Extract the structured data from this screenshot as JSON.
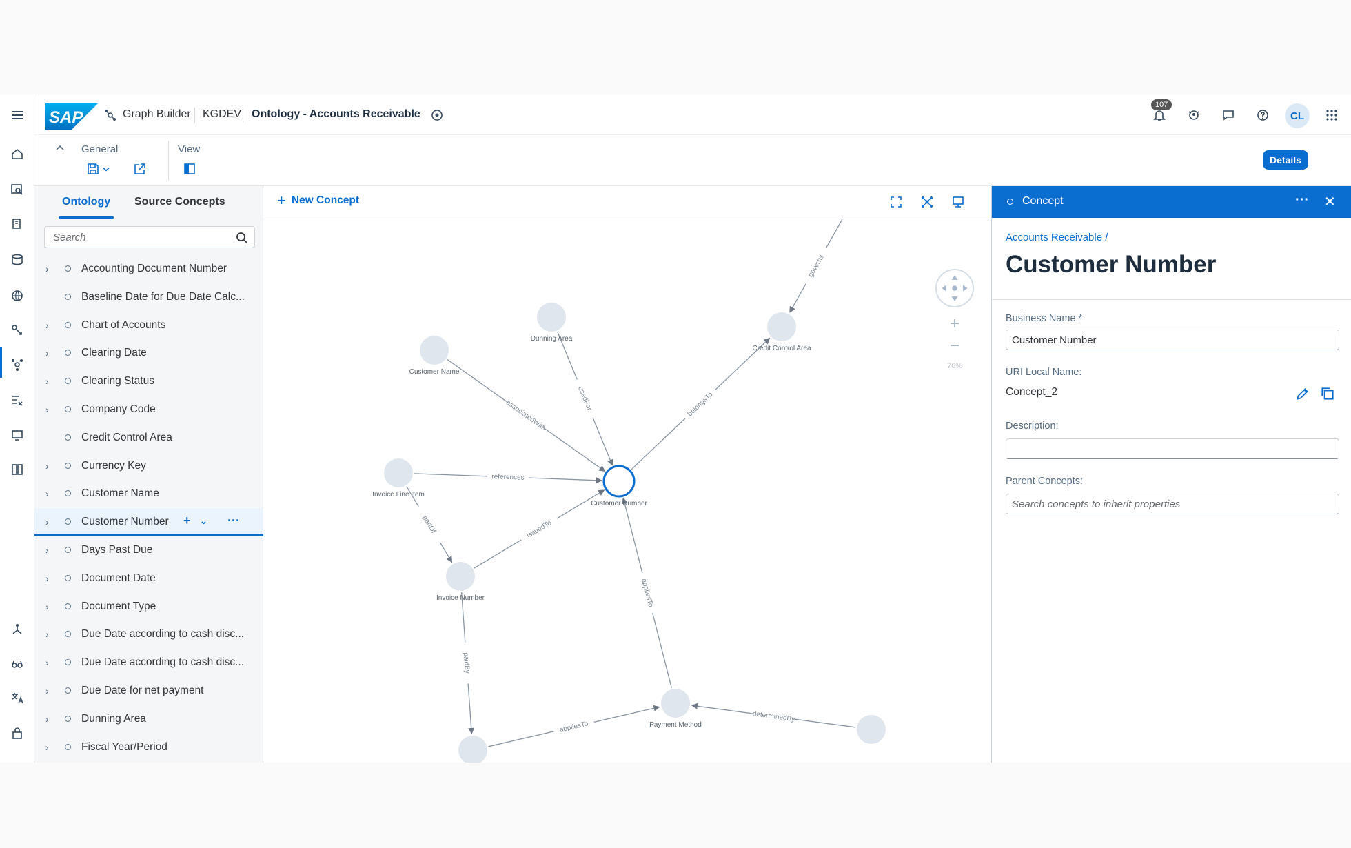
{
  "shell": {
    "logo_text": "SAP",
    "app_name": "Graph Builder",
    "system": "KGDEV",
    "document_title": "Ontology - Accounts Receivable",
    "notification_count": "107",
    "user_initials": "CL"
  },
  "toolbar": {
    "general_label": "General",
    "view_label": "View",
    "details_label": "Details"
  },
  "left_panel": {
    "tabs": [
      {
        "label": "Ontology",
        "active": true
      },
      {
        "label": "Source Concepts",
        "active": false
      }
    ],
    "search_placeholder": "Search",
    "tree_items": [
      {
        "label": "Accounting Document Number",
        "expandable": true
      },
      {
        "label": "Baseline Date for Due Date Calc...",
        "expandable": false
      },
      {
        "label": "Chart of Accounts",
        "expandable": true
      },
      {
        "label": "Clearing Date",
        "expandable": true
      },
      {
        "label": "Clearing Status",
        "expandable": true
      },
      {
        "label": "Company Code",
        "expandable": true
      },
      {
        "label": "Credit Control Area",
        "expandable": false
      },
      {
        "label": "Currency Key",
        "expandable": true
      },
      {
        "label": "Customer Name",
        "expandable": true
      },
      {
        "label": "Customer Number",
        "expandable": true,
        "selected": true
      },
      {
        "label": "Days Past Due",
        "expandable": true
      },
      {
        "label": "Document Date",
        "expandable": true
      },
      {
        "label": "Document Type",
        "expandable": true
      },
      {
        "label": "Due Date according to cash disc...",
        "expandable": true
      },
      {
        "label": "Due Date according to cash disc...",
        "expandable": true
      },
      {
        "label": "Due Date for net payment",
        "expandable": true
      },
      {
        "label": "Dunning Area",
        "expandable": true
      },
      {
        "label": "Fiscal Year/Period",
        "expandable": true
      }
    ]
  },
  "canvas": {
    "new_concept_label": "New Concept",
    "zoom_level": "76%",
    "nodes": [
      {
        "id": "dunning",
        "label": "Dunning Area"
      },
      {
        "id": "custname",
        "label": "Customer Name"
      },
      {
        "id": "credit",
        "label": "Credit Control Area"
      },
      {
        "id": "invline",
        "label": "Invoice Line Item"
      },
      {
        "id": "custnum",
        "label": "Customer Number",
        "focused": true
      },
      {
        "id": "invnum",
        "label": "Invoice Number"
      },
      {
        "id": "paymeth",
        "label": "Payment Method"
      },
      {
        "id": "bottomleft",
        "label": ""
      },
      {
        "id": "bottomright",
        "label": ""
      }
    ],
    "edges": [
      {
        "label": "governs"
      },
      {
        "label": "associatedWith"
      },
      {
        "label": "usedFor"
      },
      {
        "label": "belongsTo"
      },
      {
        "label": "references"
      },
      {
        "label": "partOf"
      },
      {
        "label": "issuedTo"
      },
      {
        "label": "appliesTo"
      },
      {
        "label": "paidBy"
      },
      {
        "label": "appliesTo"
      },
      {
        "label": "determinedBy"
      }
    ]
  },
  "right_panel": {
    "header_title": "Concept",
    "breadcrumb": "Accounts Receivable /",
    "title": "Customer Number",
    "business_name_label": "Business Name:*",
    "business_name_value": "Customer Number",
    "uri_label": "URI Local Name:",
    "uri_value": "Concept_2",
    "description_label": "Description:",
    "description_value": "",
    "parent_label": "Parent Concepts:",
    "parent_placeholder": "Search concepts to inherit properties"
  },
  "colors": {
    "accent": "#0a6ed1",
    "node_fill": "#dfe6ee",
    "edge": "#8a96a3"
  }
}
